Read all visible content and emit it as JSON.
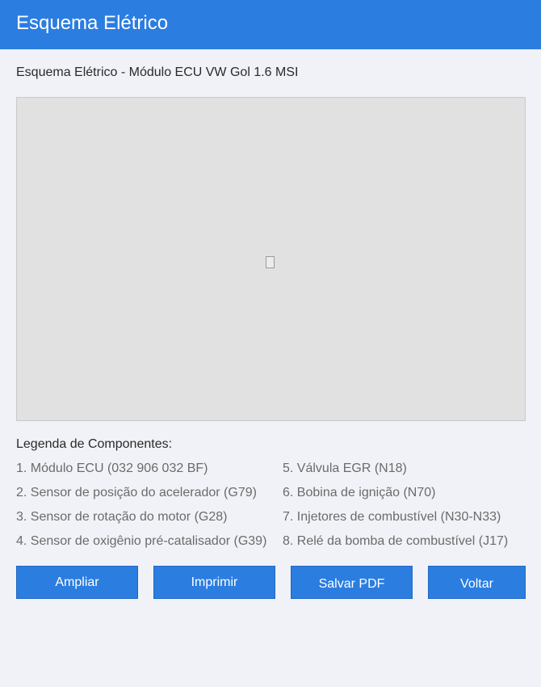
{
  "header": {
    "title": "Esquema Elétrico"
  },
  "page": {
    "subtitle": "Esquema Elétrico - Módulo ECU VW Gol 1.6 MSI"
  },
  "diagram": {
    "icon": "broken-image-icon"
  },
  "legend": {
    "title": "Legenda de Componentes:",
    "items": [
      "1. Módulo ECU (032 906 032 BF)",
      "2. Sensor de posição do acelerador (G79)",
      "3. Sensor de rotação do motor (G28)",
      "4. Sensor de oxigênio pré-catalisador (G39)",
      "5. Válvula EGR (N18)",
      "6. Bobina de ignição (N70)",
      "7. Injetores de combustível (N30-N33)",
      "8. Relé da bomba de combustível (J17)"
    ]
  },
  "actions": {
    "zoom_label": "Ampliar",
    "print_label": "Imprimir",
    "save_pdf_label": "Salvar PDF",
    "back_label": "Voltar"
  },
  "colors": {
    "header": "#2b7de0",
    "button": "#2b7de0",
    "background": "#f0f2f7",
    "diagram_bg": "#e1e1e1"
  }
}
